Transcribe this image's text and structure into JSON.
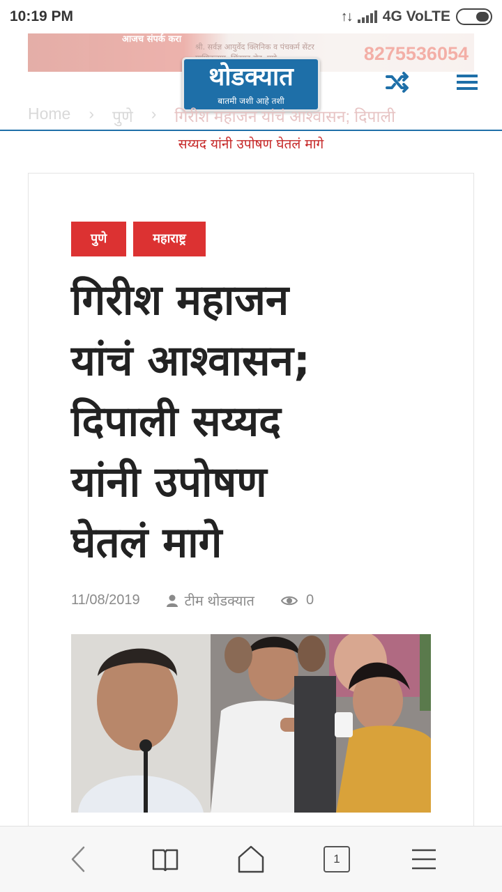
{
  "status_bar": {
    "time": "10:19 PM",
    "network": "4G VoLTE"
  },
  "ad_banner": {
    "left_text": "आजच संपर्क करा",
    "mid_text_1": "श्री. सर्वज्ञ आयुर्वेद क्लिनिक व पंचकर्म सेंटर",
    "mid_text_2": "माणिकबाग, सिंहगड रोड, पुणे",
    "phone": "8275536054"
  },
  "header": {
    "logo_text": "थोडक्यात",
    "logo_tagline": "बातमी जशी आहे तशी",
    "accent_color": "#1e6fa8"
  },
  "breadcrumb": {
    "home": "Home",
    "separator": "›",
    "category": "पुणे",
    "current_line1": "गिरीश महाजन यांचं आश्वासन; दिपाली",
    "current_line2": "सय्यद यांनी उपोषण घेतलं मागे"
  },
  "article": {
    "tags": [
      "पुणे",
      "महाराष्ट्र"
    ],
    "tag_color": "#dc3232",
    "headline_lines": [
      "गिरीश महाजन",
      "यांचं आश्वासन;",
      "दिपाली सय्यद",
      "यांनी उपोषण",
      "घेतलं मागे"
    ],
    "date": "11/08/2019",
    "author": "टीम थोडक्यात",
    "views": "0"
  },
  "bottom_nav": {
    "tab_count": "1"
  }
}
